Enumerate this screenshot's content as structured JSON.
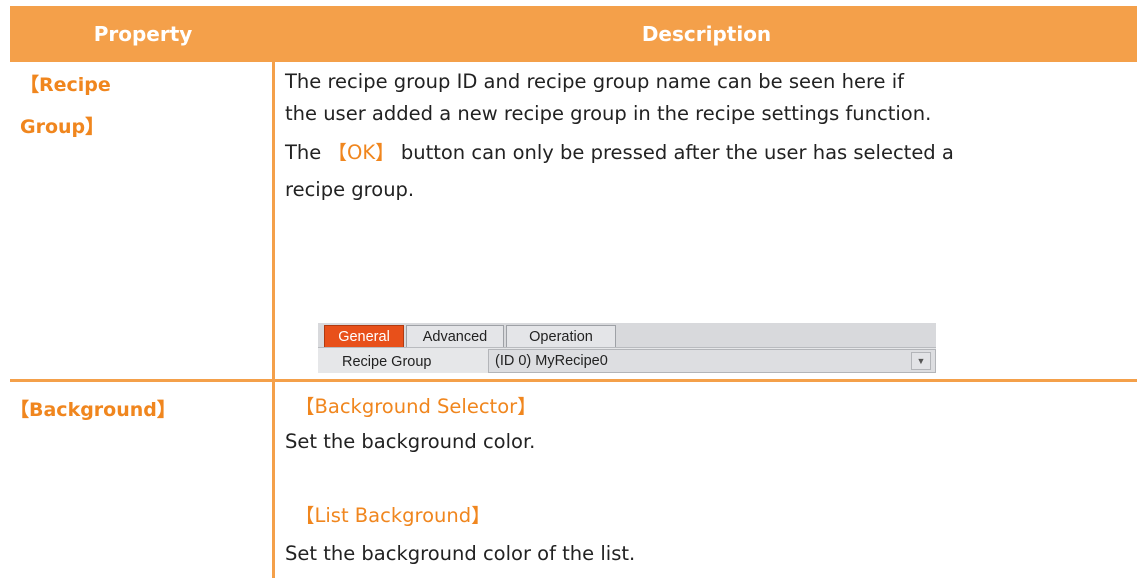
{
  "header": {
    "property": "Property",
    "description": "Description"
  },
  "rows": [
    {
      "property_line1": "【Recipe",
      "property_line2": "Group】",
      "desc_line1": "The recipe group ID and recipe group name can be seen here if",
      "desc_line2": "the user added a new recipe group in the recipe settings function.",
      "desc_line3_pre": "The",
      "desc_line3_ok": "【OK】",
      "desc_line3_post": "button can only be pressed after the user has selected a",
      "desc_line4": "recipe group."
    },
    {
      "property": "【Background】",
      "sub1_title": "【Background Selector】",
      "sub1_desc": "Set the background color.",
      "sub2_title": "【List Background】",
      "sub2_desc": "Set the background color of the list."
    }
  ],
  "screenshot": {
    "tabs": [
      "General",
      "Advanced",
      "Operation"
    ],
    "active_tab": "General",
    "field_label": "Recipe Group",
    "field_value": "(ID 0) MyRecipe0"
  },
  "colors": {
    "accent": "#f4a04a",
    "label": "#f0861e",
    "active_tab": "#e8501a"
  }
}
